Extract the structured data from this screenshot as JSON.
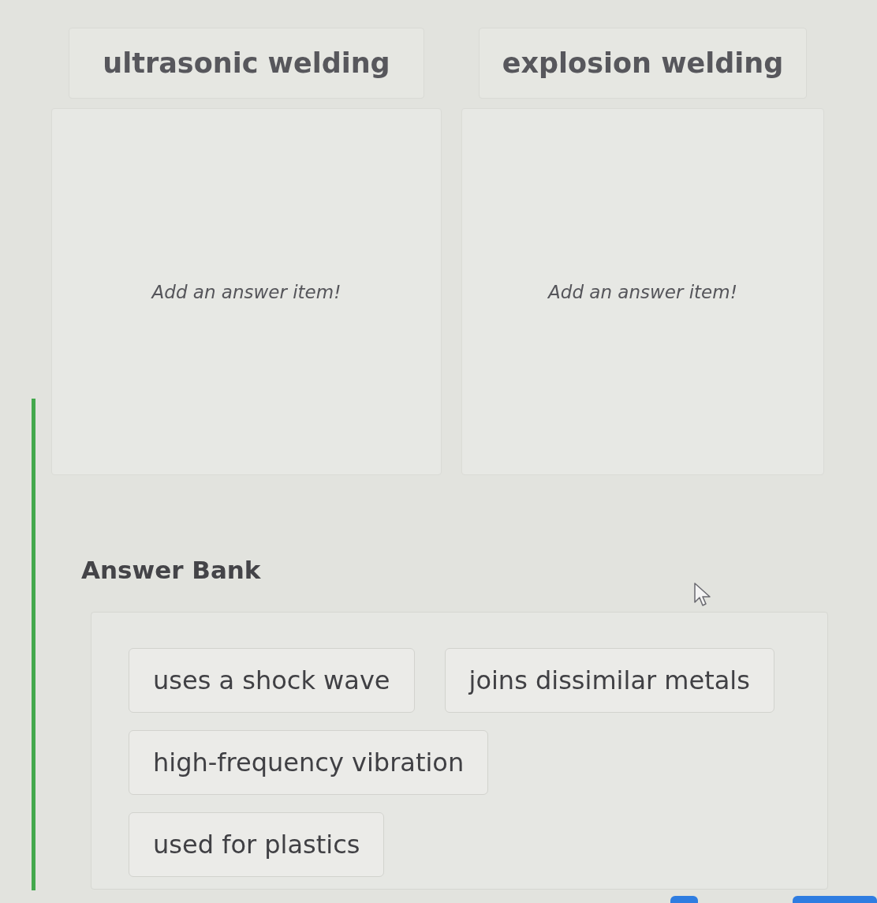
{
  "categories": [
    {
      "title": "ultrasonic welding",
      "placeholder": "Add an answer item!"
    },
    {
      "title": "explosion welding",
      "placeholder": "Add an answer item!"
    }
  ],
  "answer_bank": {
    "title": "Answer Bank",
    "rows": [
      [
        "uses a shock wave",
        "joins dissimilar metals"
      ],
      [
        "high-frequency vibration"
      ],
      [
        "used for plastics"
      ]
    ]
  }
}
